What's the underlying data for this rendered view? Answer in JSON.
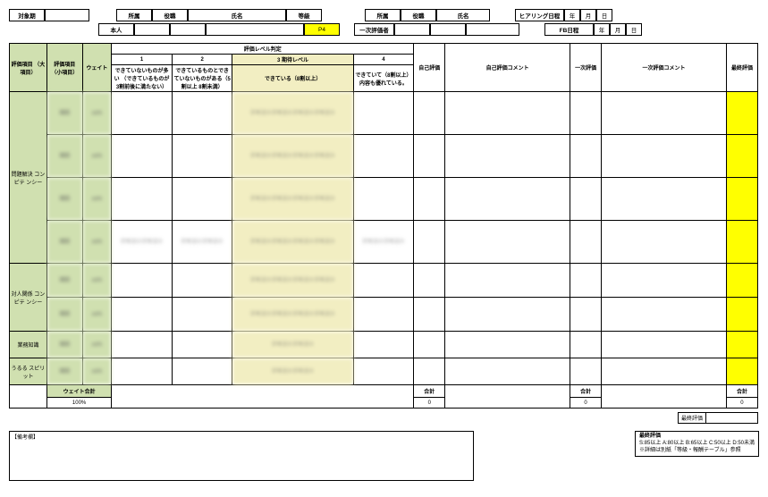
{
  "header": {
    "target_period_label": "対象期",
    "target_period_value": "",
    "left": {
      "dept_label": "所属",
      "dept_value": "",
      "title_label": "役職",
      "title_value": "",
      "name_label": "氏名",
      "name_value": "",
      "grade_label": "等級",
      "grade_value": "",
      "self_label": "本人",
      "grade_code": "P4"
    },
    "right": {
      "dept_label": "所属",
      "dept_value": "",
      "title_label": "役職",
      "title_value": "",
      "name_label": "氏名",
      "name_value": "",
      "primary_evaluator_label": "一次評価者",
      "hearing_date_label": "ヒアリング日程",
      "fb_date_label": "FB日程",
      "year_label": "年",
      "month_label": "月",
      "day_label": "日"
    }
  },
  "columns": {
    "major_item": "評価項目\n（大項目）",
    "minor_item": "評価項目\n（小項目）",
    "weight": "ウェイト",
    "level_judgement": "評価レベル判定",
    "level1": "1",
    "level2": "2",
    "level3_header": "3\n期待レベル",
    "level4": "4",
    "level1_desc": "できていないものが多い\n（できているものが3割前後に満たない）",
    "level2_desc": "できているものとできていないものがある（5割以上\n8割未満）",
    "level3_desc": "できている（8割以上）",
    "level4_desc": "できていて（8割以上）\n内容も優れている。",
    "self_eval": "自己評価",
    "self_comment": "自己評価コメント",
    "primary_eval": "一次評価",
    "primary_comment": "一次評価コメント",
    "final_eval": "最終評価"
  },
  "categories": [
    {
      "name": "問題解決\nコンピテ\nンシー",
      "rows": 4
    },
    {
      "name": "対人関係\nコンピテ\nンシー",
      "rows": 2
    },
    {
      "name": "業務知識",
      "rows": 1
    },
    {
      "name": "うるる\nスピリット",
      "rows": 1
    }
  ],
  "totals": {
    "weight_total_label": "ウェイト合計",
    "weight_total_value": "100%",
    "sum_label": "合計",
    "sum_value": "0"
  },
  "footer": {
    "remarks_label": "【備考欄】",
    "final_eval_label": "最終評価",
    "legend_title": "最終評価",
    "legend_line1": "S:85以上  A:80以上  B:65以上  C:50以上  D:50未満",
    "legend_line2": "※詳細は別紙「等級・報酬テーブル」参照"
  }
}
